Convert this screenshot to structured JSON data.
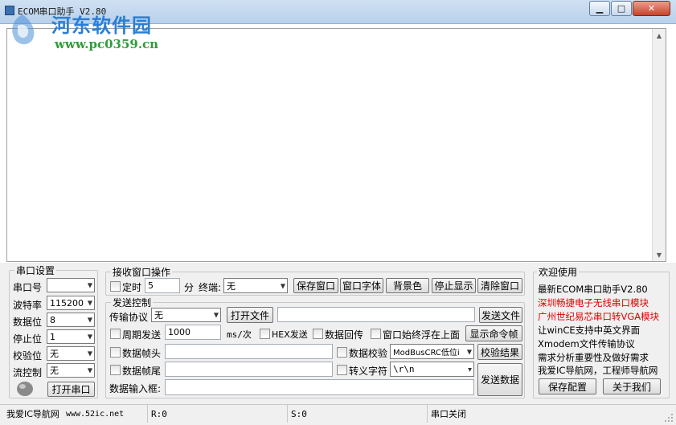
{
  "window": {
    "title": "ECOM串口助手 V2.80",
    "watermark_title": "河东软件园",
    "watermark_url": "www.pc0359.cn",
    "min_glyph": "▁",
    "max_glyph": "□",
    "close_glyph": "✕"
  },
  "serial_settings": {
    "group_title": "串口设置",
    "port_label": "串口号",
    "port_value": "",
    "baud_label": "波特率",
    "baud_value": "115200",
    "databits_label": "数据位",
    "databits_value": "8",
    "stopbits_label": "停止位",
    "stopbits_value": "1",
    "parity_label": "校验位",
    "parity_value": "无",
    "flow_label": "流控制",
    "flow_value": "无",
    "open_button": "打开串口"
  },
  "receive_ops": {
    "group_title": "接收窗口操作",
    "timer_label": "定时",
    "timer_value": "5",
    "minute_label": "分",
    "terminal_label": "终端:",
    "terminal_value": "无",
    "save_window": "保存窗口",
    "window_font": "窗口字体",
    "background": "背景色",
    "stop_display": "停止显示",
    "clear_window": "清除窗口"
  },
  "send_ctrl": {
    "group_title": "发送控制",
    "protocol_label": "传输协议",
    "protocol_value": "无",
    "open_file": "打开文件",
    "file_path": "",
    "send_file": "发送文件",
    "periodic_label": "周期发送",
    "period_value": "1000",
    "period_unit": "ms/次",
    "hex_send": "HEX发送",
    "data_echo": "数据回传",
    "float_top": "窗口始终浮在上面",
    "show_cmd_frame": "显示命令帧",
    "frame_head_label": "数据帧头",
    "frame_head_value": "",
    "checksum_label": "数据校验",
    "checksum_value": "ModBusCRC低位i",
    "checksum_result": "校验结果",
    "frame_tail_label": "数据帧尾",
    "frame_tail_value": "",
    "escape_label": "转义字符",
    "escape_value": "\\r\\n",
    "input_label": "数据输入框:",
    "input_value": "",
    "send_data": "发送数据"
  },
  "welcome": {
    "group_title": "欢迎使用",
    "lines": [
      "最新ECOM串口助手V2.80",
      "深圳畅捷电子无线串口模块",
      "广州世纪易芯串口转VGA模块",
      "让winCE支持中英文界面",
      "Xmodem文件传输协议",
      "需求分析重要性及做好需求",
      "我爱IC导航网，工程师导航网"
    ],
    "save_config": "保存配置",
    "about_us": "关于我们"
  },
  "status": {
    "link_text": "我爱IC导航网",
    "url_text": "www.52ic.net",
    "recv_count": "R:0",
    "send_count": "S:0",
    "port_state": "串口关闭"
  },
  "colors": {
    "highlight_red": "#e00000",
    "panel_bg": "#f0f0f0",
    "title_blue": "#b9d1ec"
  }
}
